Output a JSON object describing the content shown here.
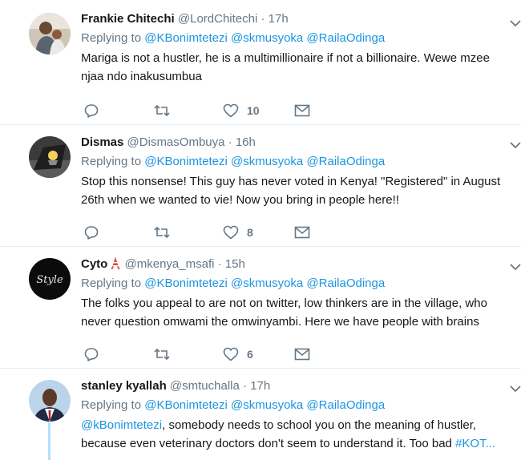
{
  "replying_label": "Replying to",
  "tweets": [
    {
      "fullname": "Frankie Chitechi",
      "username": "@LordChitechi",
      "sep": "·",
      "time": "17h",
      "mentions": [
        "@KBonimtetezi",
        "@skmusyoka",
        "@RailaOdinga"
      ],
      "text": "Mariga is not a hustler, he is a multimillionaire if not a billionaire. Wewe mzee njaa ndo inakusumbua",
      "likes": "10"
    },
    {
      "fullname": "Dismas",
      "username": "@DismasOmbuya",
      "sep": "·",
      "time": "16h",
      "mentions": [
        "@KBonimtetezi",
        "@skmusyoka",
        "@RailaOdinga"
      ],
      "text": "Stop this nonsense! This guy has never voted in Kenya! \"Registered\" in August 26th when we wanted to vie! Now you bring in people here!!",
      "likes": "8"
    },
    {
      "fullname": "Cyto",
      "username": "@mkenya_msafi",
      "sep": "·",
      "time": "15h",
      "mentions": [
        "@KBonimtetezi",
        "@skmusyoka",
        "@RailaOdinga"
      ],
      "text": "The folks you appeal to are not on twitter, low thinkers are in the village, who never question omwami the omwinyambi. Here we have people with brains",
      "likes": "6",
      "avatar_script": "Style"
    },
    {
      "fullname": "stanley kyallah",
      "username": "@smtuchalla",
      "sep": "·",
      "time": "17h",
      "mentions": [
        "@KBonimtetezi",
        "@skmusyoka",
        "@RailaOdinga"
      ],
      "text_mention": "@kBonimtetezi",
      "text": ", somebody needs to school you on the meaning of hustler, because even veterinary doctors don't seem to understand it. Too bad",
      "text_cut": "#KOT..."
    }
  ],
  "colors": {
    "accent": "#1b95e0",
    "muted": "#657786",
    "text": "#14171a",
    "divider": "#e6ecf0",
    "thread": "#b2dffb"
  },
  "icons": [
    "reply-icon",
    "retweet-icon",
    "like-icon",
    "direct-message-icon",
    "chevron-down-icon",
    "tokyo-tower-emoji"
  ]
}
